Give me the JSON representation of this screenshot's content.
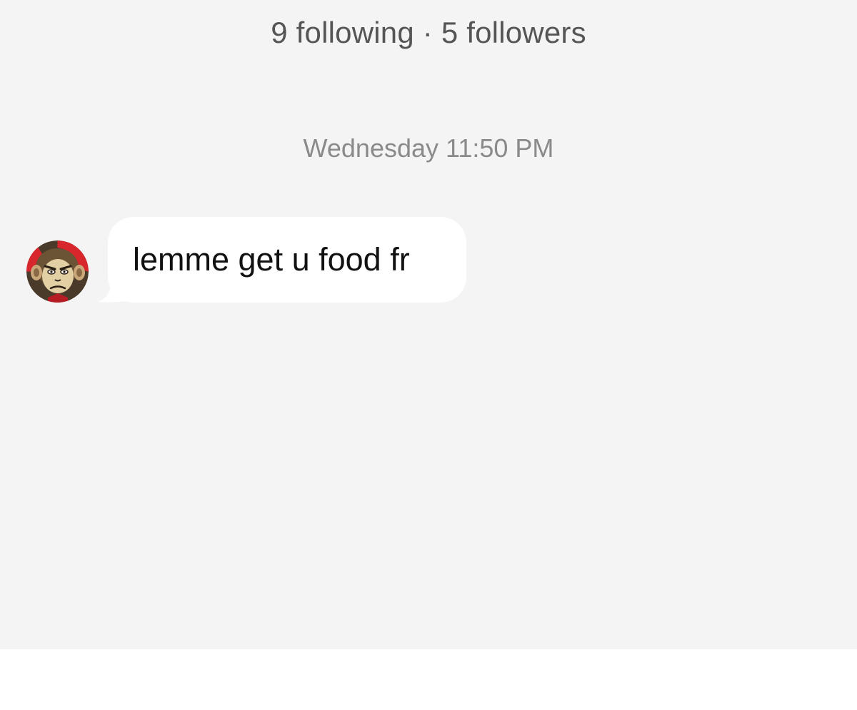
{
  "header": {
    "follow_stats": "9 following · 5 followers"
  },
  "conversation": {
    "timestamp": "Wednesday 11:50 PM",
    "messages": [
      {
        "direction": "incoming",
        "text": "lemme get u food fr"
      }
    ]
  },
  "colors": {
    "chat_background": "#f4f4f4",
    "bubble_incoming": "#ffffff",
    "stats_text": "#555555",
    "timestamp_text": "#8a8a8a",
    "avatar_ring": "#d7262c"
  },
  "icons": {
    "sender_avatar": "monkey-avatar-icon"
  }
}
